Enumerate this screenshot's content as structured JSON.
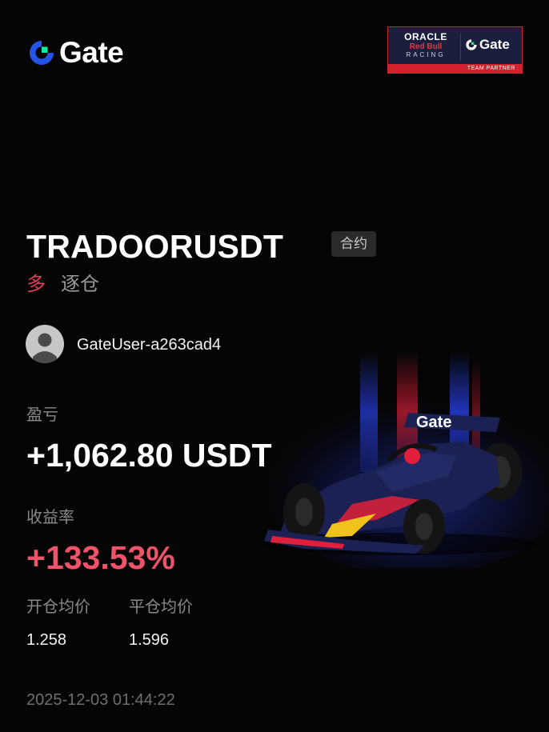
{
  "brand": {
    "name": "Gate",
    "accent": "#2354e6",
    "accent_green": "#17e5a3"
  },
  "partner_badge": {
    "oracle": "ORACLE",
    "red_bull": "Red Bull",
    "racing": "RACING",
    "gate": "Gate",
    "caption": "TEAM PARTNER"
  },
  "trade": {
    "pair": "TRADOORUSDT",
    "type_tag": "合约",
    "side": "多",
    "margin_mode": "逐仓"
  },
  "user": {
    "name": "GateUser-a263cad4",
    "avatar_icon": "user-avatar-icon"
  },
  "stats": {
    "pnl_label": "盈亏",
    "pnl_value": "+1,062.80 USDT",
    "roi_label": "收益率",
    "roi_value": "+133.53%",
    "open_label": "开仓均价",
    "open_value": "1.258",
    "close_label": "平仓均价",
    "close_value": "1.596"
  },
  "timestamp": "2025-12-03 01:44:22",
  "car_livery": "Gate",
  "colors": {
    "profit": "#f0526a",
    "long": "#e2405a",
    "muted": "#8a8a8a",
    "background": "#050505"
  }
}
